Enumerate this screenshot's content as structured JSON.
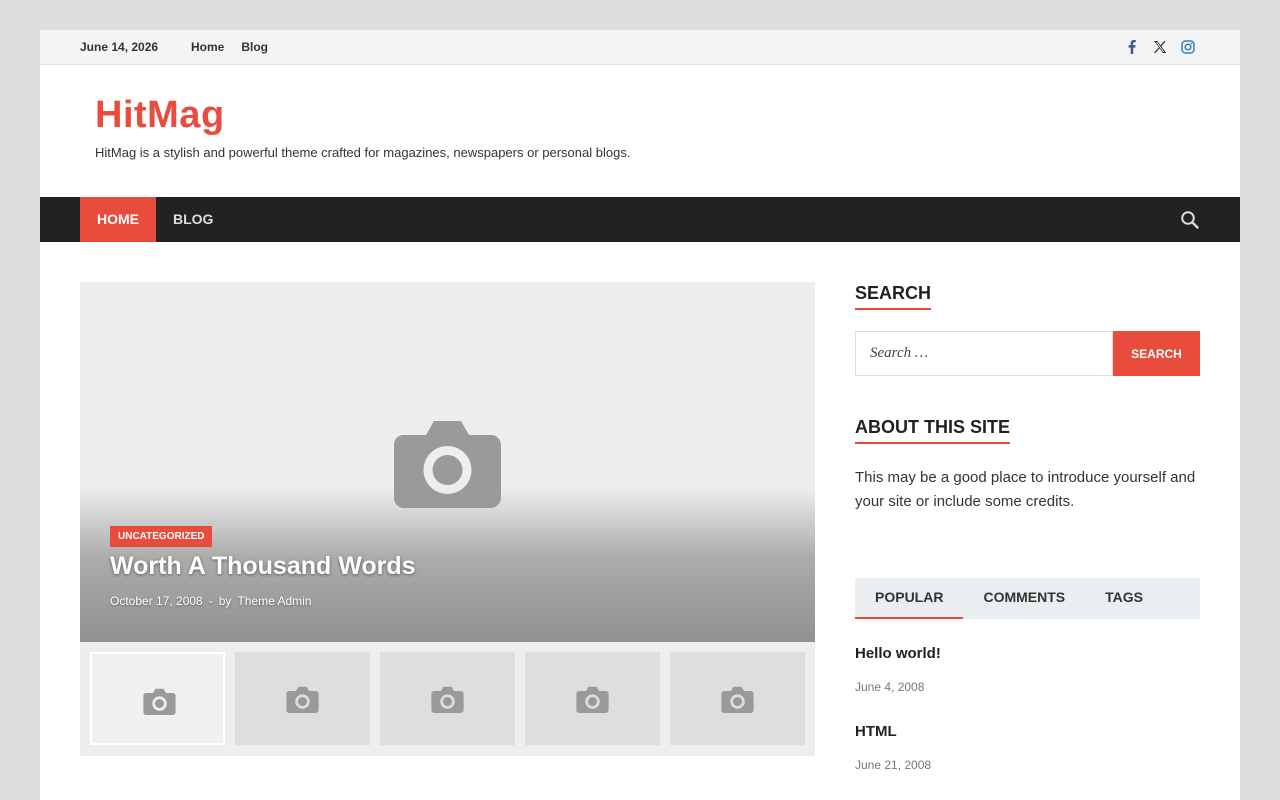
{
  "topbar": {
    "date": "June 14, 2026",
    "links": [
      "Home",
      "Blog"
    ],
    "social": [
      "facebook-icon",
      "x-twitter-icon",
      "instagram-icon"
    ]
  },
  "header": {
    "title": "HitMag",
    "tagline": "HitMag is a stylish and powerful theme crafted for magazines, newspapers or personal blogs."
  },
  "nav": {
    "items": [
      "Home",
      "Blog"
    ],
    "search_icon": "search-icon"
  },
  "slider": {
    "category": "Uncategorized",
    "title": "Worth A Thousand Words",
    "date": "October 17, 2008",
    "separator": "-",
    "by": "by",
    "author": "Theme Admin"
  },
  "sidebar": {
    "search": {
      "title": "Search",
      "placeholder": "Search …",
      "button": "Search"
    },
    "about": {
      "title": "About This Site",
      "text": "This may be a good place to introduce yourself and your site or include some credits."
    },
    "tabs": [
      "Popular",
      "Comments",
      "Tags"
    ],
    "posts": [
      {
        "title": "Hello world!",
        "date": "June 4, 2008"
      },
      {
        "title": "HTML",
        "date": "June 21, 2008"
      }
    ]
  },
  "colors": {
    "accent": "#e74c3c",
    "nav_bg": "#222222",
    "topbar_bg": "#f2f4f5"
  }
}
